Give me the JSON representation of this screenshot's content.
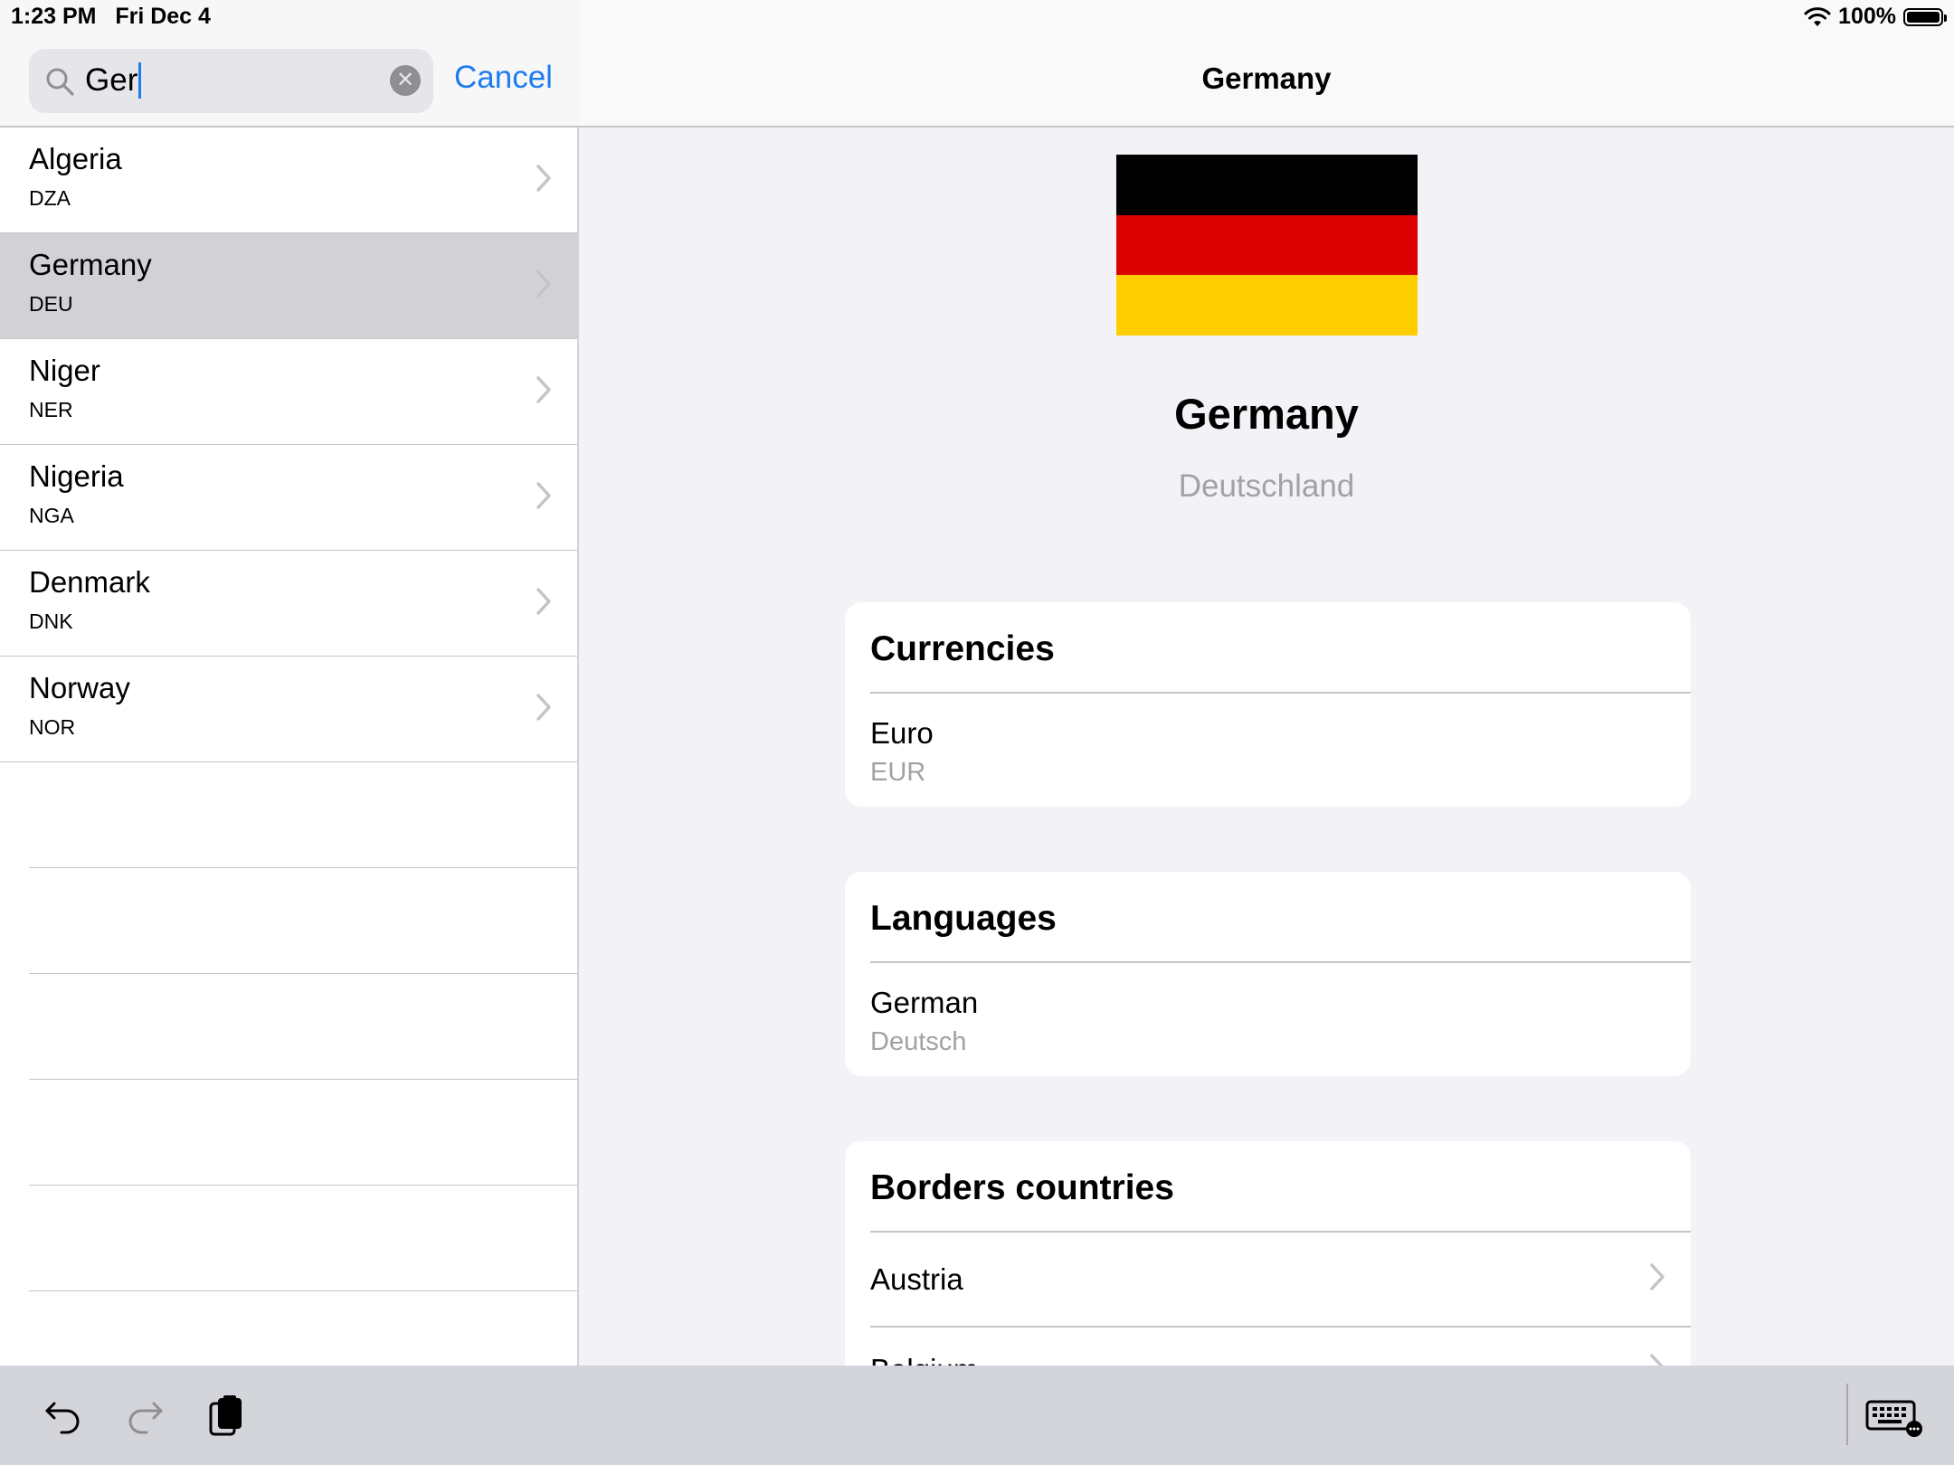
{
  "status_bar": {
    "time": "1:23 PM",
    "date": "Fri Dec 4",
    "battery": "100%",
    "battery_level": 1.0
  },
  "search": {
    "query": "Ger",
    "cancel_label": "Cancel"
  },
  "countries": [
    {
      "name": "Algeria",
      "code": "DZA",
      "selected": false
    },
    {
      "name": "Germany",
      "code": "DEU",
      "selected": true
    },
    {
      "name": "Niger",
      "code": "NER",
      "selected": false
    },
    {
      "name": "Nigeria",
      "code": "NGA",
      "selected": false
    },
    {
      "name": "Denmark",
      "code": "DNK",
      "selected": false
    },
    {
      "name": "Norway",
      "code": "NOR",
      "selected": false
    }
  ],
  "detail": {
    "nav_title": "Germany",
    "flag_colors": [
      "#000000",
      "#DD0000",
      "#FFCE00"
    ],
    "name": "Germany",
    "native_name": "Deutschland",
    "currencies": {
      "title": "Currencies",
      "items": [
        {
          "name": "Euro",
          "code": "EUR"
        }
      ]
    },
    "languages": {
      "title": "Languages",
      "items": [
        {
          "name": "German",
          "native": "Deutsch"
        }
      ]
    },
    "borders": {
      "title": "Borders countries",
      "items": [
        "Austria",
        "Belgium"
      ]
    }
  },
  "colors": {
    "accent": "#1F7CF0",
    "selected_row": "#D1D1D6",
    "secondary_text": "#A1A1A6"
  },
  "toolbar": {
    "icons": [
      "undo-icon",
      "redo-icon",
      "paste-icon",
      "keyboard-hide-icon"
    ]
  }
}
